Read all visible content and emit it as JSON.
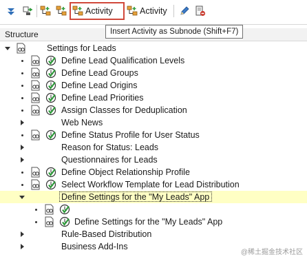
{
  "toolbar": {
    "activity_label": "Activity",
    "activity2_label": "Activity",
    "tooltip": "Insert Activity as Subnode   (Shift+F7)"
  },
  "header": {
    "label": "Structure"
  },
  "tree": {
    "root": "Settings for Leads",
    "items": [
      "Define Lead Qualification Levels",
      "Define Lead Groups",
      "Define Lead Origins",
      "Define Lead Priorities",
      "Assign Classes for Deduplication",
      "Web News",
      "Define Status Profile for User Status",
      "Reason for Status: Leads",
      "Questionnaires for Leads",
      "Define Object Relationship Profile",
      "Select Workflow Template for Lead Distribution",
      "Define Settings for the \"My Leads\" App",
      "",
      "Define Settings for the \"My Leads\" App",
      "Rule-Based Distribution",
      "Business Add-Ins"
    ]
  },
  "watermark": "@稀土掘金技术社区",
  "colors": {
    "selected_row": "#ffffc4",
    "highlight_border": "#d0473a",
    "exec_green": "#2e9b3a"
  }
}
